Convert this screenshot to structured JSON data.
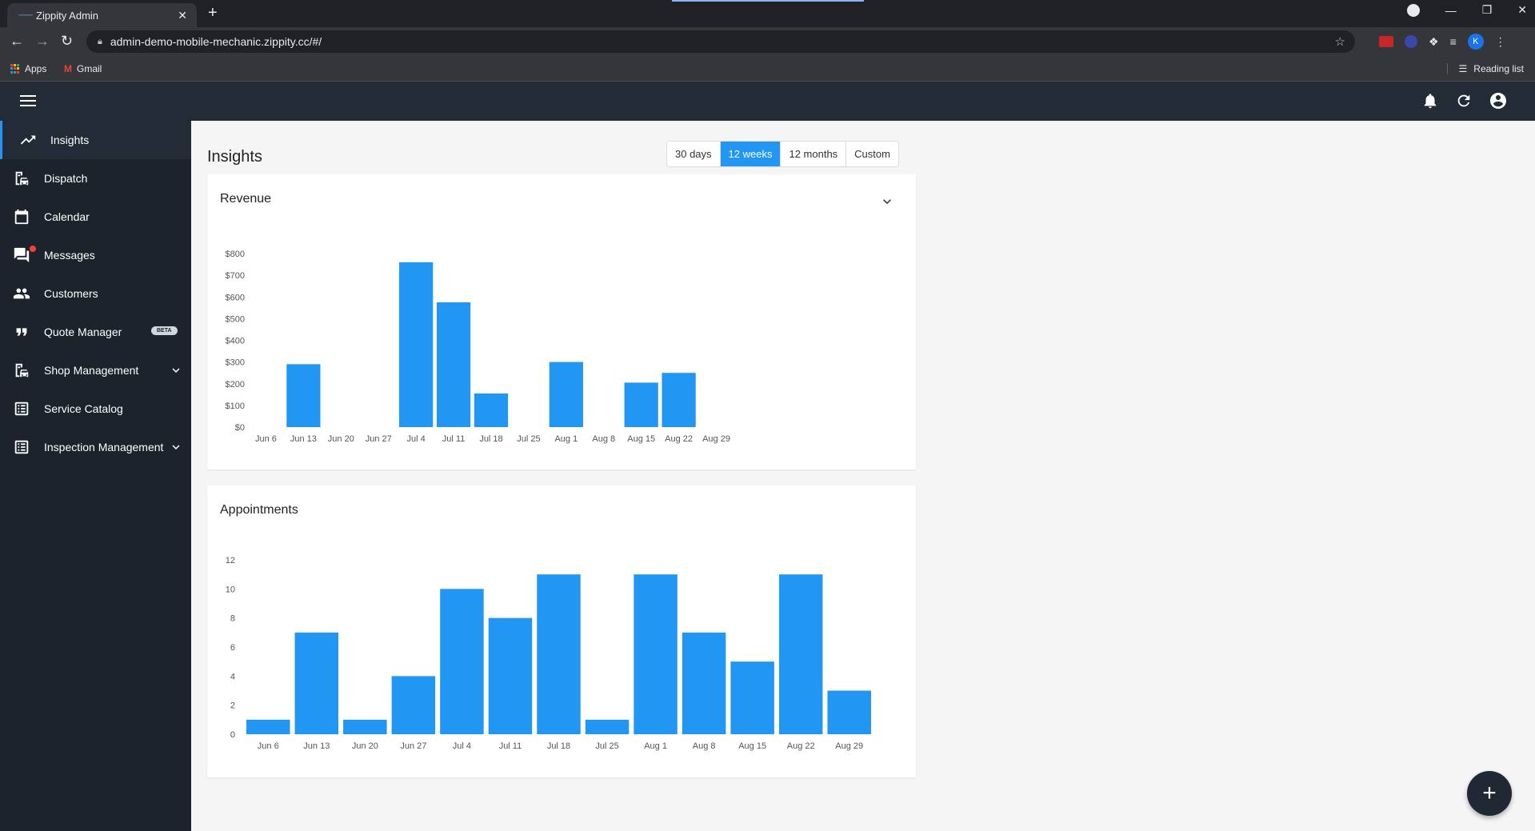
{
  "browser": {
    "tab_title": "Zippity Admin",
    "tab_close": "✕",
    "new_tab": "+",
    "url": "admin-demo-mobile-mechanic.zippity.cc/#/",
    "avatar_letter": "K",
    "bookmarks": [
      {
        "label": "Apps",
        "icon": "apps-grid-icon"
      },
      {
        "label": "Gmail",
        "icon": "gmail-icon"
      }
    ],
    "reading_list": "Reading list"
  },
  "appbar": {
    "icons": [
      "menu-icon",
      "bell-icon",
      "refresh-icon",
      "account-circle-icon"
    ]
  },
  "sidebar": {
    "items": [
      {
        "label": "Insights",
        "icon": "trending-up-icon",
        "active": true
      },
      {
        "label": "Dispatch",
        "icon": "dispatch-icon"
      },
      {
        "label": "Calendar",
        "icon": "calendar-icon"
      },
      {
        "label": "Messages",
        "icon": "messages-icon",
        "has_notification": true
      },
      {
        "label": "Customers",
        "icon": "customers-icon"
      },
      {
        "label": "Quote Manager",
        "icon": "quote-icon",
        "badge": "BETA"
      },
      {
        "label": "Shop Management",
        "icon": "shop-icon",
        "expandable": true
      },
      {
        "label": "Service Catalog",
        "icon": "list-icon"
      },
      {
        "label": "Inspection Management",
        "icon": "list-icon",
        "expandable": true
      }
    ]
  },
  "main": {
    "title": "Insights",
    "ranges": [
      "30 days",
      "12 weeks",
      "12 months",
      "Custom"
    ],
    "selected_range": "12 weeks"
  },
  "colors": {
    "accent": "#2196f3",
    "sidebar_bg": "#1c232d",
    "header_bg": "#222b36",
    "bar": "#2196f3"
  },
  "fab_label": "+",
  "chart_data": [
    {
      "type": "bar",
      "title": "Revenue",
      "categories": [
        "Jun 6",
        "Jun 13",
        "Jun 20",
        "Jun 27",
        "Jul 4",
        "Jul 11",
        "Jul 18",
        "Jul 25",
        "Aug 1",
        "Aug 8",
        "Aug 15",
        "Aug 22",
        "Aug 29"
      ],
      "values": [
        0,
        290,
        0,
        0,
        760,
        575,
        155,
        0,
        300,
        0,
        205,
        250,
        0
      ],
      "yticks": [
        "$0",
        "$100",
        "$200",
        "$300",
        "$400",
        "$500",
        "$600",
        "$700",
        "$800"
      ],
      "ylim": [
        0,
        800
      ],
      "grid": false
    },
    {
      "type": "bar",
      "title": "Appointments",
      "categories": [
        "Jun 6",
        "Jun 13",
        "Jun 20",
        "Jun 27",
        "Jul 4",
        "Jul 11",
        "Jul 18",
        "Jul 25",
        "Aug 1",
        "Aug 8",
        "Aug 15",
        "Aug 22",
        "Aug 29"
      ],
      "values": [
        1,
        7,
        1,
        4,
        10,
        8,
        11,
        1,
        11,
        7,
        5,
        11,
        3
      ],
      "yticks": [
        "0",
        "2",
        "4",
        "6",
        "8",
        "10",
        "12"
      ],
      "ylim": [
        0,
        12
      ],
      "grid": false
    }
  ]
}
